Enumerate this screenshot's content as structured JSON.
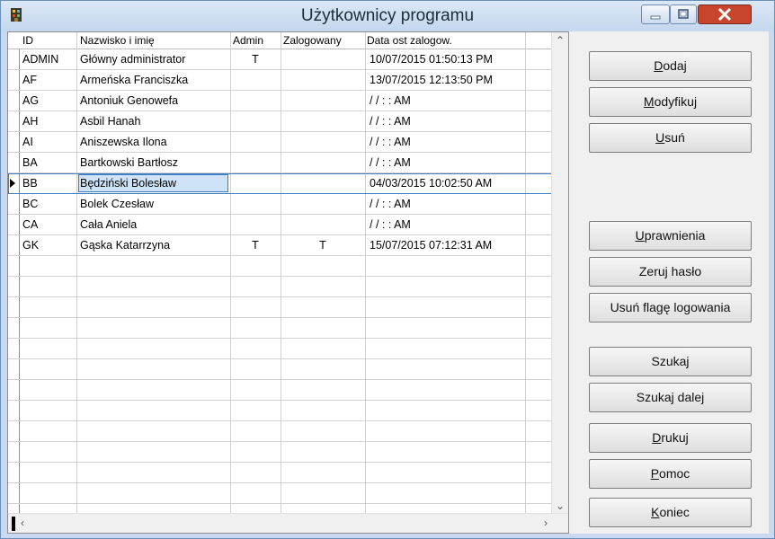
{
  "window": {
    "title": "Użytkownicy programu",
    "close_color": "#c8442c"
  },
  "table": {
    "headers": [
      "ID",
      "Nazwisko i imię",
      "Admin",
      "Zalogowany",
      "Data ost zalogow."
    ],
    "rows": [
      {
        "id": "ADMIN",
        "name": "Główny administrator",
        "admin": "T",
        "logged": "",
        "date": "10/07/2015 01:50:13 PM"
      },
      {
        "id": "AF",
        "name": "Armeńska Franciszka",
        "admin": "",
        "logged": "",
        "date": "13/07/2015 12:13:50 PM"
      },
      {
        "id": "AG",
        "name": "Antoniuk Genowefa",
        "admin": "",
        "logged": "",
        "date": "/ /      : :  AM"
      },
      {
        "id": "AH",
        "name": "Asbil Hanah",
        "admin": "",
        "logged": "",
        "date": "/ /      : :  AM"
      },
      {
        "id": "AI",
        "name": "Aniszewska Ilona",
        "admin": "",
        "logged": "",
        "date": "/ /      : :  AM"
      },
      {
        "id": "BA",
        "name": "Bartkowski Bartłosz",
        "admin": "",
        "logged": "",
        "date": "/ /      : :  AM"
      },
      {
        "id": "BB",
        "name": "Będziński Bolesław",
        "admin": "",
        "logged": "",
        "date": "04/03/2015 10:02:50 AM"
      },
      {
        "id": "BC",
        "name": "Bolek Czesław",
        "admin": "",
        "logged": "",
        "date": "/ /      : :  AM"
      },
      {
        "id": "CA",
        "name": "Cała Aniela",
        "admin": "",
        "logged": "",
        "date": "/ /      : :  AM"
      },
      {
        "id": "GK",
        "name": "Gąska Katarrzyna",
        "admin": "T",
        "logged": "T",
        "date": "15/07/2015 07:12:31 AM"
      }
    ],
    "current_row_id": "BB"
  },
  "buttons": {
    "dodaj": {
      "pre": "",
      "u": "D",
      "post": "odaj"
    },
    "modyfikuj": {
      "pre": "",
      "u": "M",
      "post": "odyfikuj"
    },
    "usun": {
      "pre": "",
      "u": "U",
      "post": "suń"
    },
    "uprawnienia": {
      "pre": "",
      "u": "U",
      "post": "prawnienia"
    },
    "zeruj_haslo": {
      "pre": "Zeruj hasło",
      "u": "",
      "post": ""
    },
    "usun_flage": {
      "pre": "Usuń flagę logowania",
      "u": "",
      "post": ""
    },
    "szukaj": {
      "pre": "Szukaj",
      "u": "",
      "post": ""
    },
    "szukaj_dalej": {
      "pre": "Szukaj dalej",
      "u": "",
      "post": ""
    },
    "drukuj": {
      "pre": "",
      "u": "D",
      "post": "rukuj"
    },
    "pomoc": {
      "pre": "",
      "u": "P",
      "post": "omoc"
    },
    "koniec": {
      "pre": "",
      "u": "K",
      "post": "oniec"
    }
  }
}
